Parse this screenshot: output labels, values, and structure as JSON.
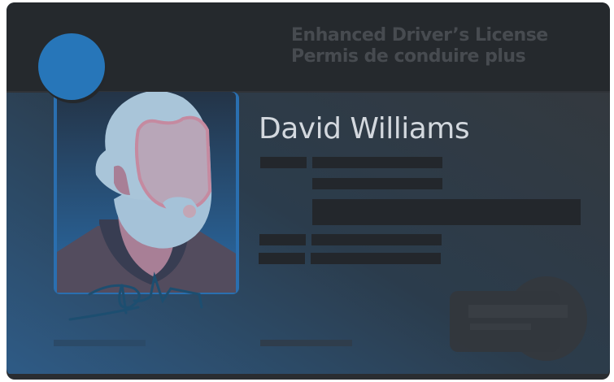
{
  "card": {
    "title_en": "Enhanced Driver’s License",
    "title_fr": "Permis de conduire plus",
    "holder_name": "David Williams",
    "signature": "DW"
  },
  "colors": {
    "accent_blue": "#2776b9",
    "header": "#25292d",
    "body_dark": "#35383c",
    "body_blue": "#2d5a85"
  }
}
